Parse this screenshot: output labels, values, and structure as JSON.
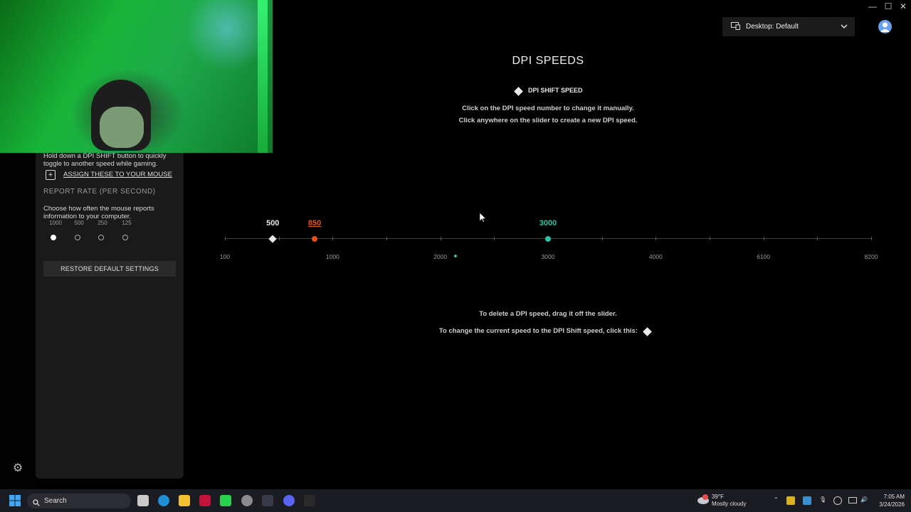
{
  "window": {
    "minimize": "—",
    "maximize": "☐",
    "close": "✕"
  },
  "profile": {
    "label": "Desktop: Default"
  },
  "sidebar": {
    "dpi_shift_help": "Hold down a DPI SHIFT button to quickly toggle to another speed while gaming.",
    "assign_link": "ASSIGN THESE TO YOUR MOUSE",
    "report_rate_title": "REPORT RATE (PER SECOND)",
    "report_rate_help": "Choose how often the mouse reports information to your computer.",
    "report_rates": [
      "1000",
      "500",
      "250",
      "125"
    ],
    "selected_rate": "1000",
    "restore_button": "RESTORE DEFAULT SETTINGS"
  },
  "main": {
    "title": "DPI SPEEDS",
    "shift_label": "DPI SHIFT SPEED",
    "instr1": "Click on the DPI speed number to change it manually.",
    "instr2": "Click anywhere on the slider to create a new DPI speed.",
    "delete_hint": "To delete a DPI speed, drag it off the slider.",
    "change_hint": "To change the current speed to the DPI Shift speed, click this:"
  },
  "slider": {
    "axis_labels": [
      "100",
      "1000",
      "2000",
      "3000",
      "4000",
      "6100",
      "8200"
    ],
    "markers": [
      {
        "value": "500",
        "kind": "shift",
        "color": "#e6e6e6"
      },
      {
        "value": "850",
        "kind": "speed",
        "color": "#e2531b"
      },
      {
        "value": "3000",
        "kind": "current",
        "color": "#2ec4a0"
      }
    ],
    "default_indicator": "2000"
  },
  "colors": {
    "accent": "#2ec4a0",
    "orange": "#e2531b",
    "panel": "#1a1a1a"
  },
  "taskbar": {
    "search": "Search",
    "weather_temp": "39°F",
    "weather_desc": "Mostly cloudy",
    "time": "7:05 AM",
    "date": "3/24/2026"
  }
}
